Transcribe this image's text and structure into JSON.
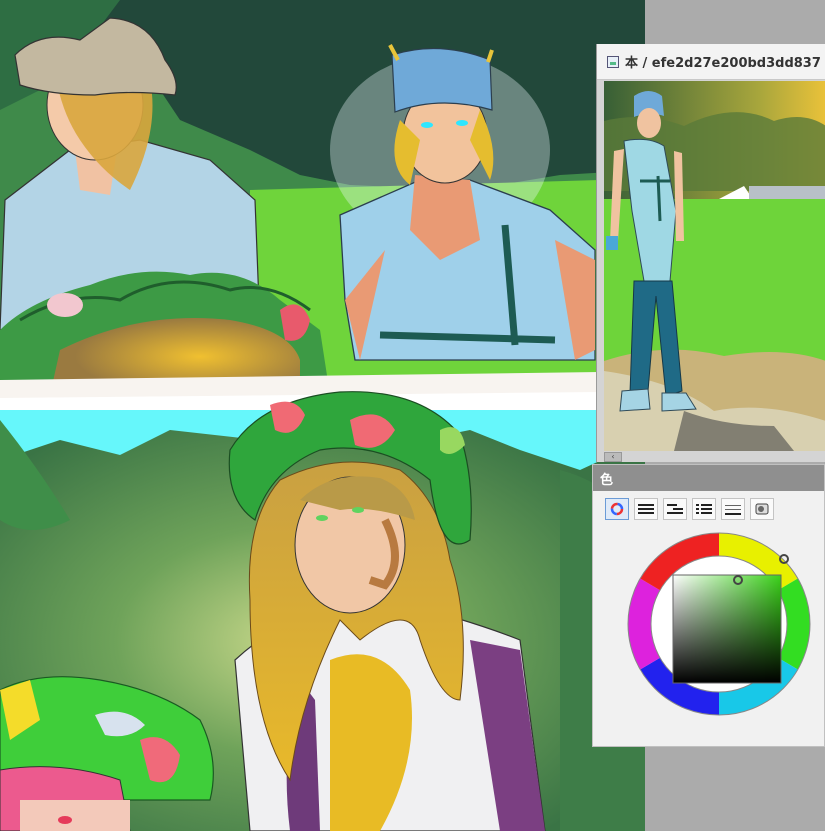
{
  "reference_panel": {
    "title": "本 / efe2d27e200bd3dd837",
    "scroll_left_glyph": "‹"
  },
  "color_panel": {
    "title": "色",
    "tabs": [
      "color-wheel",
      "color-sliders",
      "color-set",
      "swatch-list",
      "intermediate-colors",
      "approximate-color"
    ],
    "active_tab": "color-wheel",
    "main_color": "#3bd21a"
  },
  "colors": {
    "canvas_dark_green": "#23473a",
    "canvas_mid_green": "#3d8049",
    "grass_green": "#6ed43a",
    "water_cyan": "#69f9ff",
    "shirt_blue": "#9fd0ea",
    "hair_gold": "#e6b830"
  }
}
